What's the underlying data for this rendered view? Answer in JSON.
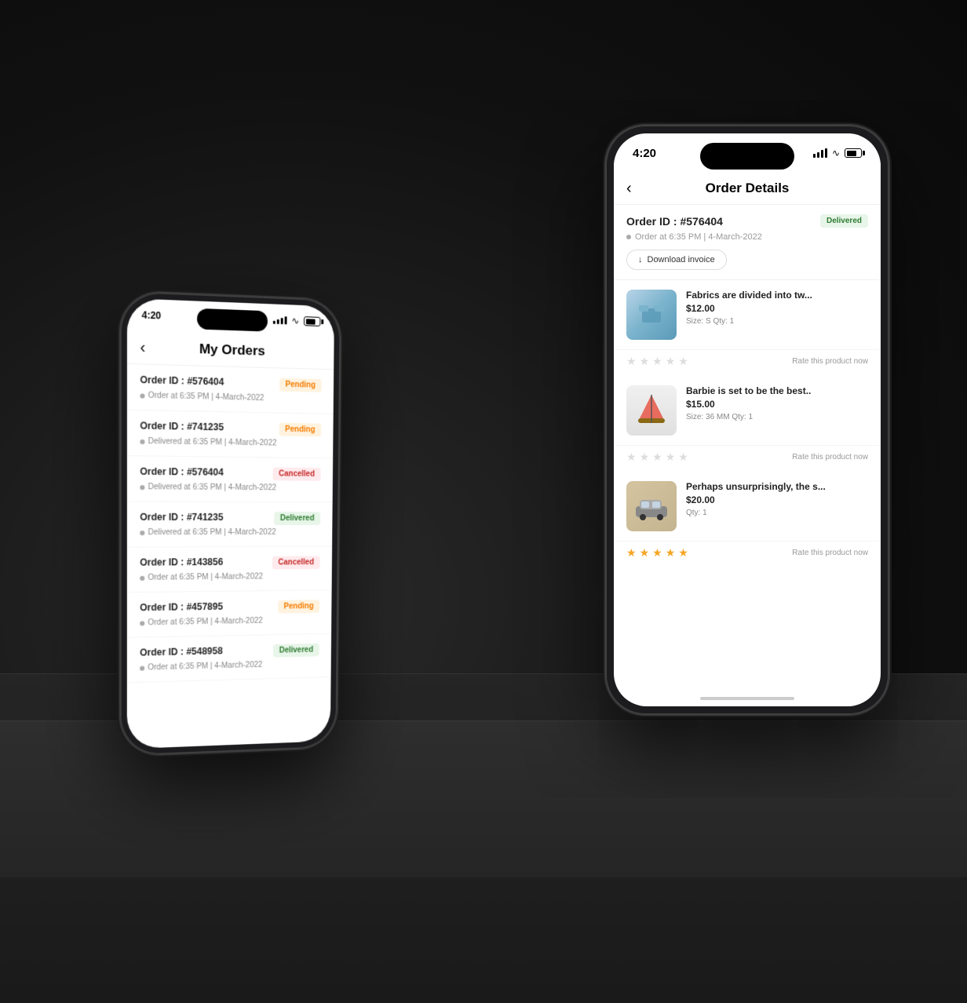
{
  "scene": {
    "background": "#1a1a1a"
  },
  "phone1": {
    "statusBar": {
      "time": "4:20"
    },
    "header": {
      "back": "‹",
      "title": "My Orders"
    },
    "orders": [
      {
        "id": "Order ID : #576404",
        "date": "Order at 6:35 PM | 4-March-2022",
        "status": "Pending",
        "statusType": "pending"
      },
      {
        "id": "Order ID : #741235",
        "date": "Delivered at 6:35 PM | 4-March-2022",
        "status": "Pending",
        "statusType": "pending"
      },
      {
        "id": "Order ID : #576404",
        "date": "Delivered at 6:35 PM | 4-March-2022",
        "status": "Cancelled",
        "statusType": "cancelled"
      },
      {
        "id": "Order ID : #741235",
        "date": "Delivered at 6:35 PM | 4-March-2022",
        "status": "Delivered",
        "statusType": "delivered"
      },
      {
        "id": "Order ID : #143856",
        "date": "Order at 6:35 PM | 4-March-2022",
        "status": "Cancelled",
        "statusType": "cancelled"
      },
      {
        "id": "Order ID : #457895",
        "date": "Order at 6:35 PM | 4-March-2022",
        "status": "Pending",
        "statusType": "pending"
      },
      {
        "id": "Order ID : #548958",
        "date": "Order at 6:35 PM | 4-March-2022",
        "status": "Delivered",
        "statusType": "delivered"
      }
    ]
  },
  "phone2": {
    "statusBar": {
      "time": "4:20"
    },
    "header": {
      "back": "‹",
      "title": "Order Details"
    },
    "orderInfo": {
      "id": "Order ID : #576404",
      "status": "Delivered",
      "statusType": "delivered",
      "date": "Order at 6:35 PM | 4-March-2022",
      "downloadLabel": "Download invoice"
    },
    "products": [
      {
        "title": "Fabrics are divided into tw...",
        "price": "$12.00",
        "size": "S",
        "qty": "1",
        "meta": "Size: S   Qty: 1",
        "imgType": "blue-clothes",
        "stars": [
          false,
          false,
          false,
          false,
          false
        ],
        "rateLabel": "Rate this product now"
      },
      {
        "title": "Barbie is set to be the best..",
        "price": "$15.00",
        "size": "36 MM",
        "qty": "1",
        "meta": "Size: 36 MM   Qty: 1",
        "imgType": "boat",
        "stars": [
          false,
          false,
          false,
          false,
          false
        ],
        "rateLabel": "Rate this product now"
      },
      {
        "title": "Perhaps unsurprisingly, the s...",
        "price": "$20.00",
        "qty": "1",
        "meta": "Qty: 1",
        "imgType": "car",
        "stars": [
          true,
          true,
          true,
          true,
          true
        ],
        "rateLabel": "Rate this product now"
      }
    ]
  }
}
